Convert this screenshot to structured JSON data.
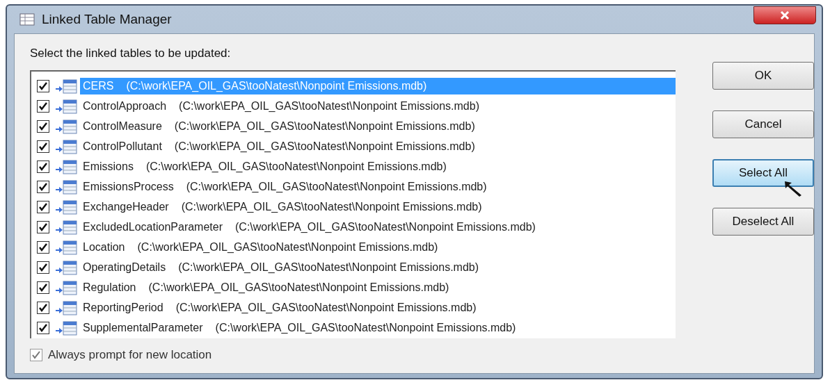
{
  "window": {
    "title": "Linked Table Manager"
  },
  "prompt": "Select the linked tables to be updated:",
  "tables": [
    {
      "name": "CERS",
      "path": "(C:\\work\\EPA_OIL_GAS\\tooNatest\\Nonpoint Emissions.mdb)",
      "checked": true,
      "selected": true
    },
    {
      "name": "ControlApproach",
      "path": "(C:\\work\\EPA_OIL_GAS\\tooNatest\\Nonpoint Emissions.mdb)",
      "checked": true,
      "selected": false
    },
    {
      "name": "ControlMeasure",
      "path": "(C:\\work\\EPA_OIL_GAS\\tooNatest\\Nonpoint Emissions.mdb)",
      "checked": true,
      "selected": false
    },
    {
      "name": "ControlPollutant",
      "path": "(C:\\work\\EPA_OIL_GAS\\tooNatest\\Nonpoint Emissions.mdb)",
      "checked": true,
      "selected": false
    },
    {
      "name": "Emissions",
      "path": "(C:\\work\\EPA_OIL_GAS\\tooNatest\\Nonpoint Emissions.mdb)",
      "checked": true,
      "selected": false
    },
    {
      "name": "EmissionsProcess",
      "path": "(C:\\work\\EPA_OIL_GAS\\tooNatest\\Nonpoint Emissions.mdb)",
      "checked": true,
      "selected": false
    },
    {
      "name": "ExchangeHeader",
      "path": "(C:\\work\\EPA_OIL_GAS\\tooNatest\\Nonpoint Emissions.mdb)",
      "checked": true,
      "selected": false
    },
    {
      "name": "ExcludedLocationParameter",
      "path": "(C:\\work\\EPA_OIL_GAS\\tooNatest\\Nonpoint Emissions.mdb)",
      "checked": true,
      "selected": false
    },
    {
      "name": "Location",
      "path": "(C:\\work\\EPA_OIL_GAS\\tooNatest\\Nonpoint Emissions.mdb)",
      "checked": true,
      "selected": false
    },
    {
      "name": "OperatingDetails",
      "path": "(C:\\work\\EPA_OIL_GAS\\tooNatest\\Nonpoint Emissions.mdb)",
      "checked": true,
      "selected": false
    },
    {
      "name": "Regulation",
      "path": "(C:\\work\\EPA_OIL_GAS\\tooNatest\\Nonpoint Emissions.mdb)",
      "checked": true,
      "selected": false
    },
    {
      "name": "ReportingPeriod",
      "path": "(C:\\work\\EPA_OIL_GAS\\tooNatest\\Nonpoint Emissions.mdb)",
      "checked": true,
      "selected": false
    },
    {
      "name": "SupplementalParameter",
      "path": "(C:\\work\\EPA_OIL_GAS\\tooNatest\\Nonpoint Emissions.mdb)",
      "checked": true,
      "selected": false
    }
  ],
  "always_prompt": {
    "label": "Always prompt for new location",
    "checked": true
  },
  "buttons": [
    {
      "label": "OK",
      "focused": false
    },
    {
      "label": "Cancel",
      "focused": false
    },
    {
      "label": "Select All",
      "focused": true
    },
    {
      "label": "Deselect All",
      "focused": false
    }
  ]
}
